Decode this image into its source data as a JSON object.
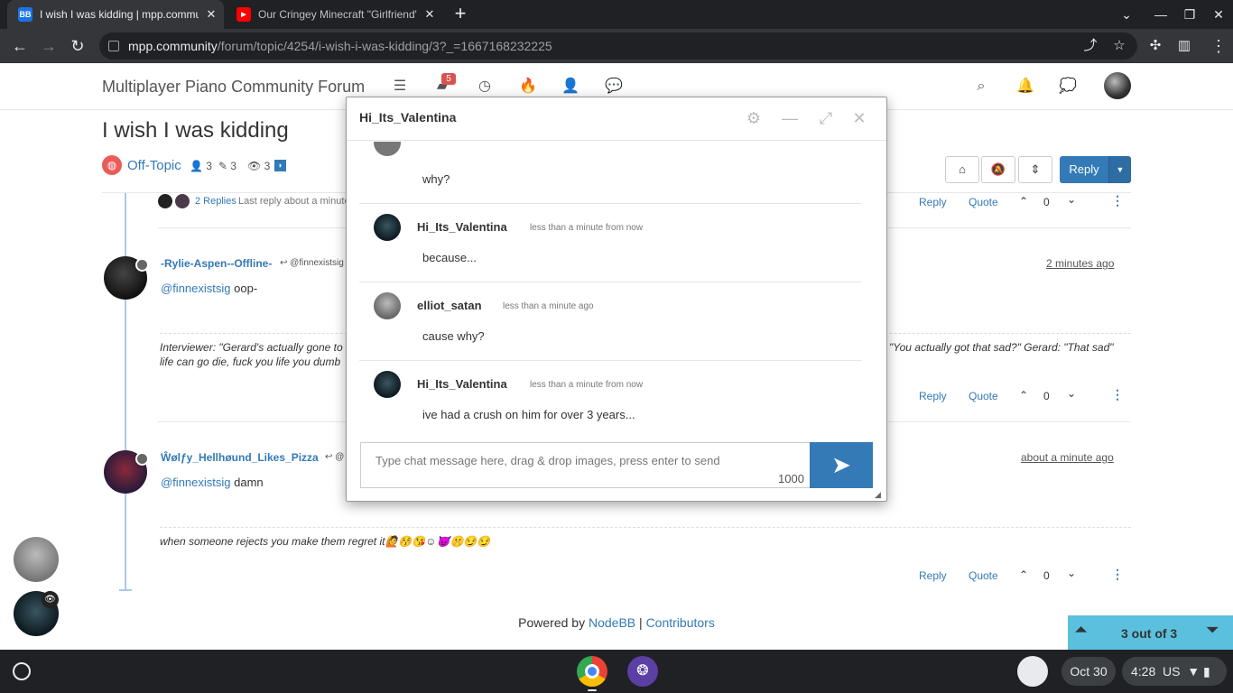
{
  "browser": {
    "tabs": [
      {
        "favicon": "BB",
        "title": "I wish I was kidding | mpp.community",
        "active": true
      },
      {
        "favicon": "▶",
        "title": "Our Cringey Minecraft \"Girlfriend\"",
        "active": false
      }
    ],
    "url": {
      "host": "mpp.community",
      "path": "/forum/topic/4254/i-wish-i-was-kidding/3?_=1667168232225"
    },
    "icons": [
      "back-icon",
      "forward-icon",
      "reload-icon",
      "share-icon",
      "bookmark-star-icon",
      "extensions-icon",
      "side-panel-icon",
      "profile-icon",
      "menu-icon"
    ]
  },
  "forum": {
    "title": "Multiplayer Piano Community Forum",
    "notification_count": "5"
  },
  "topic": {
    "title": "I wish I was kidding",
    "category": "Off-Topic",
    "posters": "3",
    "posts": "3",
    "views": "3",
    "reply_label": "Reply"
  },
  "replies_bar": {
    "replies_link": "2 Replies",
    "last_reply": "Last reply about a minute"
  },
  "posts": [
    {
      "user": "-Rylie-Aspen--Offline-",
      "reply_to": "@finnexistsig",
      "time": "2 minutes ago",
      "mention": "@finnexistsig",
      "body": " oop-",
      "sig_line1_left": "Interviewer: \"Gerard's actually gone to",
      "sig_line1_right": "\"You actually got that sad?\" Gerard: \"That sad\"",
      "sig_line2": "life can go die, fuck you life you dumb",
      "votes": "0"
    },
    {
      "user": "Ŵølƒy_Hellhøund_Likes_Pizza",
      "reply_to": "@",
      "time": "about a minute ago",
      "mention": "@finnexistsig",
      "body": " damn",
      "sig": "when someone rejects you make them regret it🙋😚😘☺😈🤫😏😏",
      "votes": "0"
    }
  ],
  "post_actions": {
    "reply": "Reply",
    "quote": "Quote",
    "top_votes": "0"
  },
  "footer": {
    "powered": "Powered by ",
    "nodebb": "NodeBB",
    "sep": " | ",
    "contributors": "Contributors"
  },
  "pager": {
    "text": "3 out of 3"
  },
  "chat": {
    "title": "Hi_Its_Valentina",
    "messages": [
      {
        "text": "why?"
      },
      {
        "user": "Hi_Its_Valentina",
        "time": "less than a minute from now",
        "text": "because..."
      },
      {
        "user": "elliot_satan",
        "time": "less than a minute ago",
        "text": "cause why?"
      },
      {
        "user": "Hi_Its_Valentina",
        "time": "less than a minute from now",
        "text": "ive had a crush on him for over 3 years..."
      }
    ],
    "input_placeholder": "Type chat message here, drag & drop images, press enter to send",
    "char_count": "1000"
  },
  "shelf": {
    "date": "Oct 30",
    "time": "4:28",
    "locale": "US"
  }
}
